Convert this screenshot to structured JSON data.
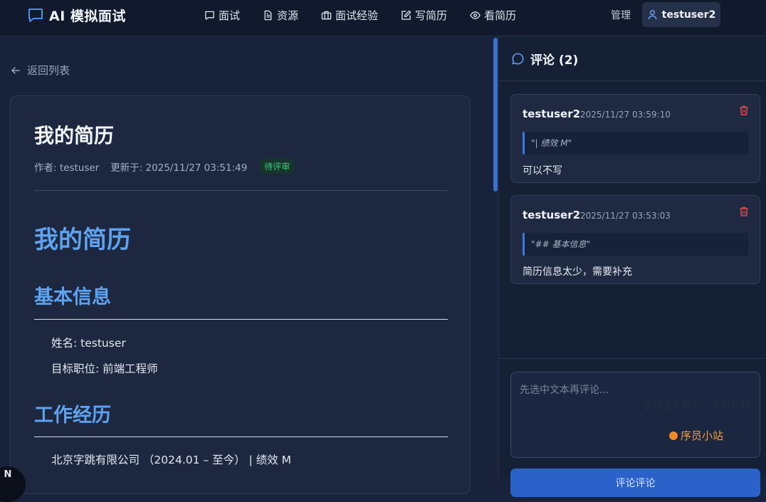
{
  "app": {
    "title": "AI 模拟面试"
  },
  "nav": {
    "items": [
      {
        "label": "面试",
        "icon": "chat-bubble-icon"
      },
      {
        "label": "资源",
        "icon": "document-icon"
      },
      {
        "label": "面试经验",
        "icon": "briefcase-icon"
      },
      {
        "label": "写简历",
        "icon": "edit-icon"
      },
      {
        "label": "看简历",
        "icon": "eye-icon"
      }
    ],
    "admin_label": "管理",
    "username": "testuser2"
  },
  "back_label": "返回列表",
  "document": {
    "title": "我的简历",
    "author": "作者: testuser",
    "updated": "更新于: 2025/11/27 03:51:49",
    "status": "待评审",
    "content": {
      "h1": "我的简历",
      "sections": [
        {
          "heading": "基本信息",
          "lines": [
            "姓名: testuser",
            "目标职位: 前端工程师"
          ]
        },
        {
          "heading": "工作经历",
          "lines": [
            "北京字跳有限公司 （2024.01 – 至今） | 绩效 M"
          ]
        }
      ]
    }
  },
  "comments_panel": {
    "title": "评论 (2)",
    "comments": [
      {
        "author": "testuser2",
        "time": "2025/11/27 03:59:10",
        "quote": "\"| 绩效 M\"",
        "text": "可以不写"
      },
      {
        "author": "testuser2",
        "time": "2025/11/27 03:53:03",
        "quote": "\"## 基本信息\"",
        "text": "简历信息太少，需要补充"
      }
    ],
    "input_placeholder": "先选中文本再评论...",
    "submit_label": "评论评论"
  },
  "watermark": {
    "code": "shiker.tech",
    "site": "序员小站"
  },
  "corner_badge": "N",
  "colors": {
    "accent": "#5ea2ef",
    "status_green": "#39d07a",
    "delete_red": "#e0484b",
    "button_blue": "#2a62c9"
  }
}
